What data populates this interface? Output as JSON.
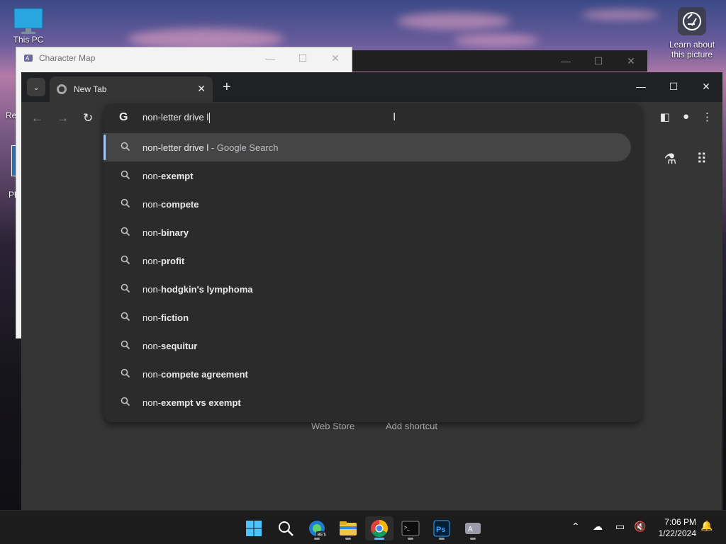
{
  "desktop": {
    "this_pc_label": "This PC",
    "learn_label": "Learn about this picture",
    "left_fragments": [
      "Re",
      "Ph"
    ]
  },
  "charmap": {
    "title": "Character Map",
    "minimize": "—",
    "maximize": "☐",
    "close": "✕"
  },
  "behind_window": {
    "minimize": "—",
    "maximize": "☐",
    "close": "✕"
  },
  "chrome": {
    "tab_title": "New Tab",
    "tab_close": "✕",
    "new_tab": "+",
    "tab_search": "⌄",
    "win_min": "—",
    "win_max": "☐",
    "win_close": "✕",
    "omnibox_text": "non-letter drive l",
    "google_letter": "G",
    "ntp_links": {
      "web_store": "Web Store",
      "add_shortcut": "Add shortcut"
    }
  },
  "suggestions": [
    {
      "prefix": "non-letter drive l",
      "bold": "",
      "suffix": " - Google Search",
      "selected": true
    },
    {
      "prefix": "non-",
      "bold": "exempt",
      "suffix": ""
    },
    {
      "prefix": "non-",
      "bold": "compete",
      "suffix": ""
    },
    {
      "prefix": "non-",
      "bold": "binary",
      "suffix": ""
    },
    {
      "prefix": "non-",
      "bold": "profit",
      "suffix": ""
    },
    {
      "prefix": "non-",
      "bold": "hodgkin's lymphoma",
      "suffix": ""
    },
    {
      "prefix": "non-",
      "bold": "fiction",
      "suffix": ""
    },
    {
      "prefix": "non-",
      "bold": "sequitur",
      "suffix": ""
    },
    {
      "prefix": "non-",
      "bold": "compete agreement",
      "suffix": ""
    },
    {
      "prefix": "non-",
      "bold": "exempt vs exempt",
      "suffix": ""
    }
  ],
  "taskbar": {
    "apps": [
      "start",
      "search",
      "edge-beta",
      "file-explorer",
      "chrome",
      "terminal",
      "photoshop",
      "character-map"
    ],
    "time": "7:06 PM",
    "date": "1/22/2024"
  },
  "colors": {
    "accent": "#4cc2ff",
    "omnibox_selected_bar": "#a8c7fa",
    "chrome_bg": "#353535"
  }
}
